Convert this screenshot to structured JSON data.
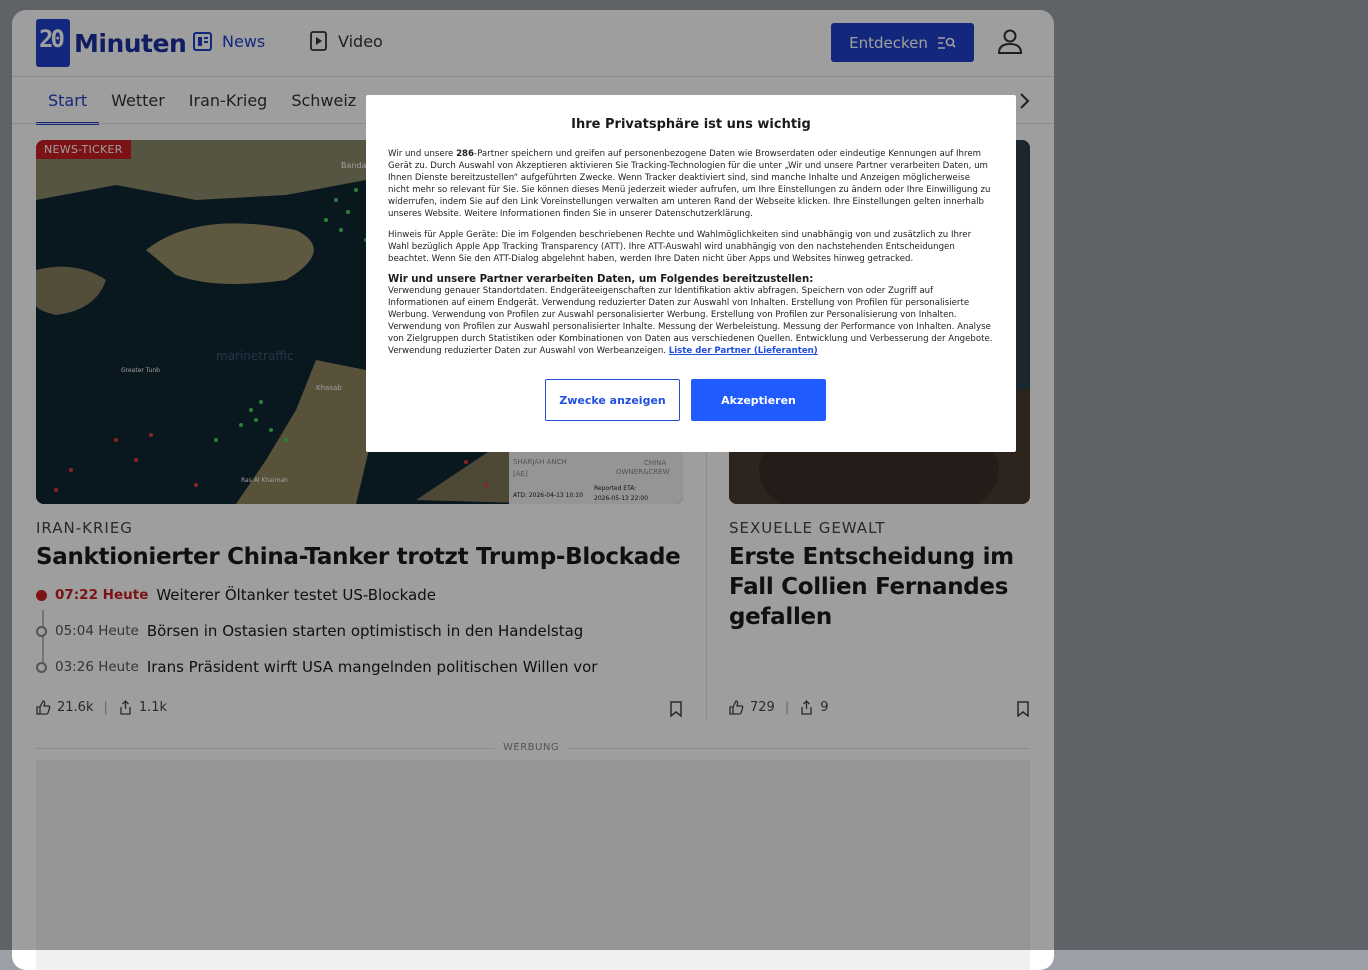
{
  "header": {
    "logo_number": "20",
    "logo_text": "Minuten",
    "nav_news": "News",
    "nav_video": "Video",
    "discover_button": "Entdecken"
  },
  "subnav": {
    "items": [
      "Start",
      "Wetter",
      "Iran-Krieg",
      "Schweiz"
    ]
  },
  "article1": {
    "badge": "NEWS-TICKER",
    "kicker": "IRAN-KRIEG",
    "headline": "Sanktionierter China-Tanker trotzt Trump-Blockade",
    "ticker": [
      {
        "time": "07:22 Heute",
        "text": "Weiterer Öltanker testet US-Blockade"
      },
      {
        "time": "05:04 Heute",
        "text": "Börsen in Ostasien starten optimistisch in den Handelstag"
      },
      {
        "time": "03:26 Heute",
        "text": "Irans Präsident wirft USA mangelnden politischen Willen vor"
      }
    ],
    "likes": "21.6k",
    "shares": "1.1k"
  },
  "article2": {
    "kicker": "SEXUELLE GEWALT",
    "headline": "Erste Entscheidung im Fall Collien Fernandes gefallen",
    "likes": "729",
    "shares": "9"
  },
  "ad": {
    "label": "WERBUNG"
  },
  "map_labels": {
    "city1": "Bandar Abbas",
    "watermark": "marinetraffic",
    "tunb": "Greater Tunb",
    "khasab": "Khasab",
    "ras": "Ras Al Khaimah",
    "sharjah": "SHARJAH ANCH",
    "ae": "[AE]",
    "china": "CHINA",
    "owner": "OWNER&CREW",
    "ata": "ATD: 2026-04-13 10:10",
    "eta": "Reported ETA:",
    "eta_date": "2026-05-13 22:00"
  },
  "consent": {
    "title": "Ihre Privatsphäre ist uns wichtig",
    "p1_before": "Wir und unsere ",
    "p1_count": "286",
    "p1_after": "-Partner speichern und greifen auf personenbezogene Daten wie Browserdaten oder eindeutige Kennungen auf Ihrem Gerät zu. Durch Auswahl von Akzeptieren aktivieren Sie Tracking-Technologien für die unter „Wir und unsere Partner verarbeiten Daten, um Ihnen Dienste bereitzustellen“ aufgeführten Zwecke. Wenn Tracker deaktiviert sind, sind manche Inhalte und Anzeigen möglicherweise nicht mehr so relevant für Sie. Sie können dieses Menü jederzeit wieder aufrufen, um Ihre Einstellungen zu ändern oder Ihre Einwilligung zu widerrufen, indem Sie auf den Link Voreinstellungen verwalten am unteren Rand der Webseite klicken. Ihre Einstellungen gelten innerhalb unseres Website. Weitere Informationen finden Sie in unserer Datenschutzerklärung.",
    "p2": "Hinweis für Apple Geräte: Die im Folgenden beschriebenen Rechte und Wahlmöglichkeiten sind unabhängig von und zusätzlich zu Ihrer Wahl bezüglich Apple App Tracking Transparency (ATT). Ihre ATT-Auswahl wird unabhängig von den nachstehenden Entscheidungen beachtet. Wenn Sie den ATT-Dialog abgelehnt haben, werden Ihre Daten nicht über Apps und Websites hinweg getracked.",
    "heading": "Wir und unsere Partner verarbeiten Daten, um Folgendes bereitzustellen:",
    "p3": "Verwendung genauer Standortdaten. Endgeräteeigenschaften zur Identifikation aktiv abfragen. Speichern von oder Zugriff auf Informationen auf einem Endgerät. Verwendung reduzierter Daten zur Auswahl von Inhalten. Erstellung von Profilen für personalisierte Werbung. Verwendung von Profilen zur Auswahl personalisierter Werbung. Erstellung von Profilen zur Personalisierung von Inhalten. Verwendung von Profilen zur Auswahl personalisierter Inhalte. Messung der Werbeleistung. Messung der Performance von Inhalten. Analyse von Zielgruppen durch Statistiken oder Kombinationen von Daten aus verschiedenen Quellen. Entwicklung und Verbesserung der Angebote. Verwendung reduzierter Daten zur Auswahl von Werbeanzeigen. ",
    "partner_link": "Liste der Partner (Lieferanten)",
    "btn_purposes": "Zwecke anzeigen",
    "btn_accept": "Akzeptieren"
  }
}
